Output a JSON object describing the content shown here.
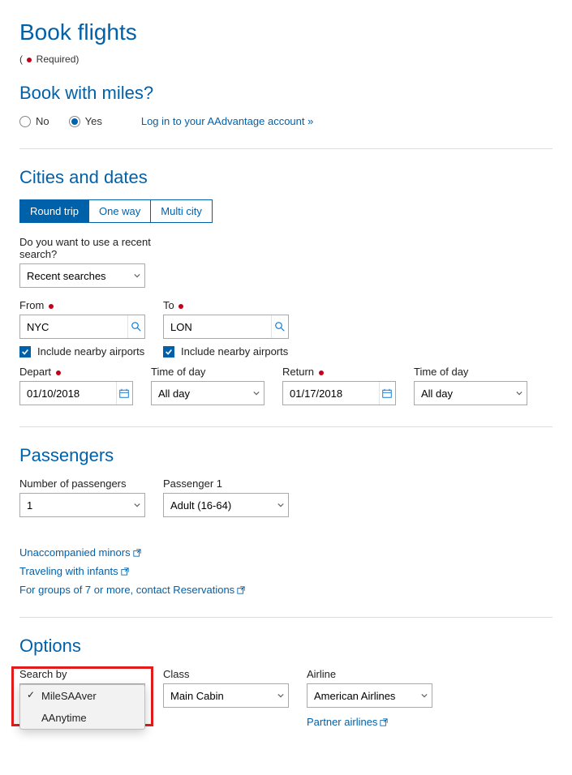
{
  "page_title": "Book flights",
  "required_legend_prefix": "( ",
  "required_legend_suffix": " Required)",
  "miles": {
    "heading": "Book with miles?",
    "no_label": "No",
    "yes_label": "Yes",
    "login_link": "Log in to your AAdvantage account »"
  },
  "cities": {
    "heading": "Cities and dates",
    "tabs": {
      "round": "Round trip",
      "oneway": "One way",
      "multi": "Multi city"
    },
    "recent_label": "Do you want to use a recent search?",
    "recent_value": "Recent searches",
    "from_label": "From",
    "from_value": "NYC",
    "to_label": "To",
    "to_value": "LON",
    "include_nearby_from": "Include nearby airports",
    "include_nearby_to": "Include nearby airports",
    "depart_label": "Depart",
    "depart_value": "01/10/2018",
    "depart_tod_label": "Time of day",
    "depart_tod_value": "All day",
    "return_label": "Return",
    "return_value": "01/17/2018",
    "return_tod_label": "Time of day",
    "return_tod_value": "All day"
  },
  "pax": {
    "heading": "Passengers",
    "count_label": "Number of passengers",
    "count_value": "1",
    "p1_label": "Passenger 1",
    "p1_value": "Adult (16-64)",
    "links": {
      "minors": "Unaccompanied minors",
      "infants": "Traveling with infants",
      "groups": "For groups of 7 or more, contact Reservations"
    }
  },
  "options": {
    "heading": "Options",
    "search_by_label": "Search by",
    "search_by_opts": [
      "MileSAAver",
      "AAnytime"
    ],
    "class_label": "Class",
    "class_value": "Main Cabin",
    "airline_label": "Airline",
    "airline_value": "American Airlines",
    "partner_link": "Partner airlines"
  }
}
